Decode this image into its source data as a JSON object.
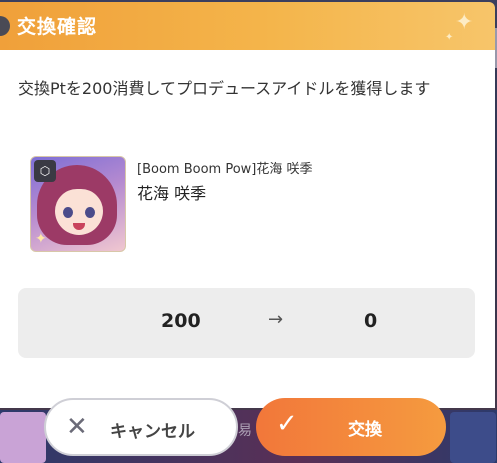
{
  "dialog": {
    "title": "交換確認",
    "message": "交換Ptを200消費してプロデュースアイドルを獲得します"
  },
  "item": {
    "title": "[Boom Boom Pow]花海 咲季",
    "name": "花海 咲季"
  },
  "points": {
    "from": "200",
    "arrow": "→",
    "to": "0"
  },
  "buttons": {
    "cancel_label": "キャンセル",
    "cancel_icon": "close-icon",
    "exchange_label": "交換",
    "exchange_icon": "check-icon"
  },
  "colors": {
    "header_accent": "#f4b54b",
    "exchange_button": "#f2773a"
  }
}
